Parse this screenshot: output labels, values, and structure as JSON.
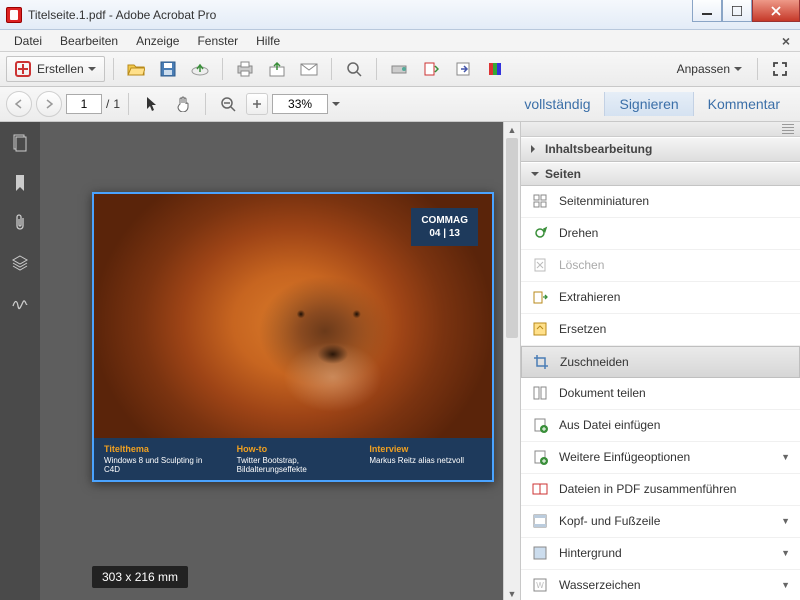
{
  "window": {
    "title": "Titelseite.1.pdf - Adobe Acrobat Pro"
  },
  "menu": {
    "items": [
      "Datei",
      "Bearbeiten",
      "Anzeige",
      "Fenster",
      "Hilfe"
    ]
  },
  "toolbar": {
    "create_label": "Erstellen",
    "customize_label": "Anpassen"
  },
  "nav": {
    "page_current": "1",
    "page_total": "1",
    "zoom": "33%"
  },
  "rightlinks": {
    "full": "vollständig",
    "sign": "Signieren",
    "comment": "Kommentar"
  },
  "doc": {
    "badge_line1": "COMMAG",
    "badge_line2": "04 | 13",
    "col1_h": "Titelthema",
    "col1_t": "Windows 8 und Sculpting in C4D",
    "col2_h": "How-to",
    "col2_t": "Twitter Bootstrap, Bildalterungseffekte",
    "col3_h": "Interview",
    "col3_t": "Markus Reitz alias netzvoll",
    "dimensions": "303 x 216 mm"
  },
  "panel": {
    "section1": "Inhaltsbearbeitung",
    "section2": "Seiten",
    "tools": [
      {
        "label": "Seitenminiaturen",
        "icon": "thumb",
        "disabled": false,
        "more": false
      },
      {
        "label": "Drehen",
        "icon": "rotate",
        "disabled": false,
        "more": false
      },
      {
        "label": "Löschen",
        "icon": "delete",
        "disabled": true,
        "more": false
      },
      {
        "label": "Extrahieren",
        "icon": "extract",
        "disabled": false,
        "more": false
      },
      {
        "label": "Ersetzen",
        "icon": "replace",
        "disabled": false,
        "more": false
      },
      {
        "label": "Zuschneiden",
        "icon": "crop",
        "disabled": false,
        "more": false,
        "selected": true
      },
      {
        "label": "Dokument teilen",
        "icon": "split",
        "disabled": false,
        "more": false
      },
      {
        "label": "Aus Datei einfügen",
        "icon": "insert",
        "disabled": false,
        "more": false
      },
      {
        "label": "Weitere Einfügeoptionen",
        "icon": "insert-more",
        "disabled": false,
        "more": true
      },
      {
        "label": "Dateien in PDF zusammenführen",
        "icon": "combine",
        "disabled": false,
        "more": false
      },
      {
        "label": "Kopf- und Fußzeile",
        "icon": "headerfooter",
        "disabled": false,
        "more": true
      },
      {
        "label": "Hintergrund",
        "icon": "background",
        "disabled": false,
        "more": true
      },
      {
        "label": "Wasserzeichen",
        "icon": "watermark",
        "disabled": false,
        "more": true
      }
    ]
  }
}
